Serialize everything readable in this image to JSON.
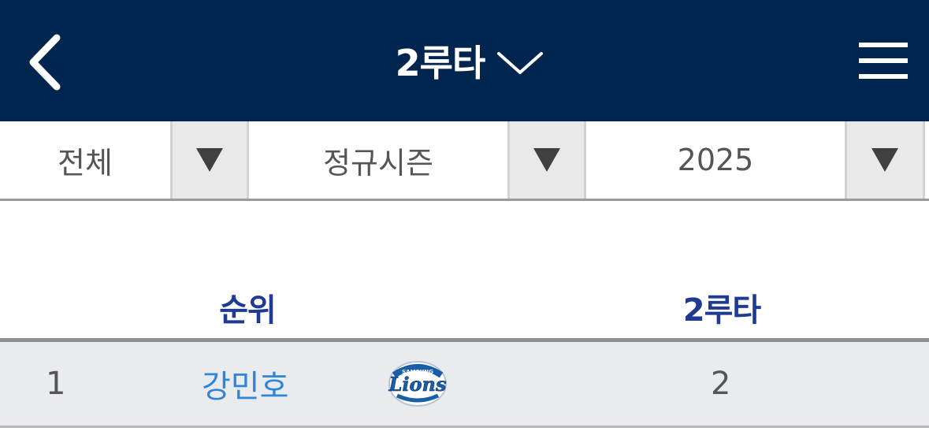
{
  "header": {
    "title": "2루타",
    "back_icon": "chevron-left-icon",
    "dropdown_icon": "chevron-down-icon",
    "menu_icon": "hamburger-menu-icon",
    "background_color": "#00254f"
  },
  "filters": [
    {
      "label": "전체",
      "arrow_icon": "dropdown-triangle-icon"
    },
    {
      "label": "정규시즌",
      "arrow_icon": "dropdown-triangle-icon"
    },
    {
      "label": "2025",
      "arrow_icon": "dropdown-triangle-icon"
    }
  ],
  "table": {
    "headers": {
      "rank": "순위",
      "stat": "2루타"
    },
    "header_color": "#1f3a93",
    "rows": [
      {
        "rank": "1",
        "player": "강민호",
        "team_logo": "samsung-lions-logo",
        "logo_text": "Lions",
        "logo_top_text": "SAMSUNG",
        "value": "2"
      }
    ]
  }
}
